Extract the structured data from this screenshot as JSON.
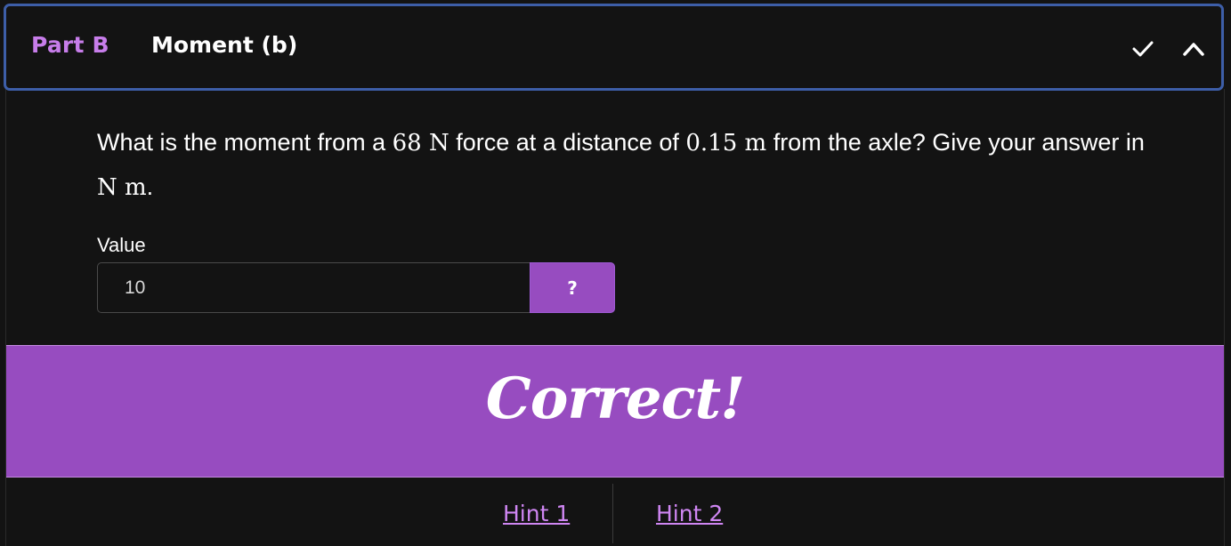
{
  "header": {
    "part_label": "Part B",
    "title": "Moment (b)",
    "status_icon": "check-icon",
    "collapse_icon": "chevron-up-icon"
  },
  "question": {
    "t1": "What is the moment from a ",
    "m1": "68 N",
    "t2": " force at a distance of ",
    "m2": "0.15 m",
    "t3": " from the axle? Give your answer in ",
    "m3": "N m",
    "t4": "."
  },
  "answer": {
    "label": "Value",
    "value": "10",
    "help_label": "?"
  },
  "feedback": {
    "text": "Correct!"
  },
  "hints": [
    {
      "label": "Hint 1"
    },
    {
      "label": "Hint 2"
    }
  ],
  "colors": {
    "accent": "#974cc0",
    "part_label": "#c77dea",
    "hint_link": "#cf86f3",
    "header_border": "#3d5ea8",
    "background": "#131313"
  }
}
